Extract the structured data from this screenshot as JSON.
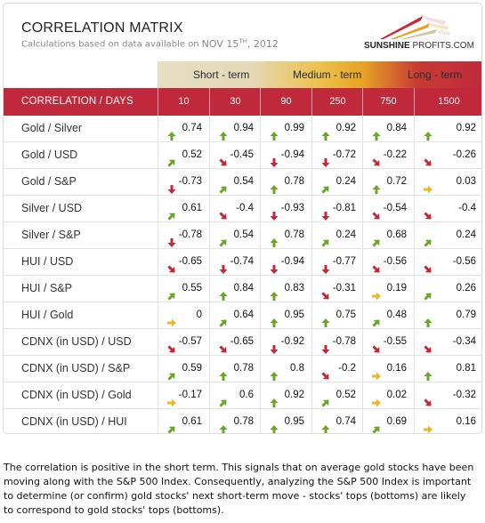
{
  "header": {
    "title": "CORRELATION MATRIX",
    "subtitle": "Calculations based on data available on",
    "date_main": "NOV 15",
    "date_sup": "TH",
    "date_year": ", 2012",
    "logo_bold": "SUNSHINE",
    "logo_rest": " PROFITS.COM"
  },
  "terms": [
    "Short - term",
    "Medium - term",
    "Long - term"
  ],
  "colors": {
    "header_red": "#c0283c",
    "up": "#6aa62a",
    "down": "#c0283c",
    "flat": "#f0b428"
  },
  "chart_data": {
    "type": "table",
    "title": "CORRELATION MATRIX",
    "row_header": "CORRELATION / DAYS",
    "columns": [
      "10",
      "30",
      "90",
      "250",
      "750",
      "1500"
    ],
    "column_groups": [
      {
        "name": "Short - term",
        "columns": [
          "10",
          "30"
        ]
      },
      {
        "name": "Medium - term",
        "columns": [
          "90",
          "250"
        ]
      },
      {
        "name": "Long - term",
        "columns": [
          "750",
          "1500"
        ]
      }
    ],
    "rows": [
      {
        "label": "Gold / Silver",
        "values": [
          "0.74",
          "0.94",
          "0.99",
          "0.92",
          "0.84",
          "0.92"
        ],
        "arrows": [
          "up",
          "up",
          "up",
          "up",
          "up",
          "up"
        ]
      },
      {
        "label": "Gold / USD",
        "values": [
          "0.52",
          "-0.45",
          "-0.94",
          "-0.72",
          "-0.22",
          "-0.26"
        ],
        "arrows": [
          "up-right",
          "down-right",
          "down",
          "down",
          "down-right",
          "down-right"
        ]
      },
      {
        "label": "Gold / S&P",
        "values": [
          "-0.73",
          "0.54",
          "0.78",
          "0.24",
          "0.72",
          "0.03"
        ],
        "arrows": [
          "down",
          "up-right",
          "up",
          "up-right",
          "up",
          "right"
        ]
      },
      {
        "label": "Silver / USD",
        "values": [
          "0.61",
          "-0.4",
          "-0.93",
          "-0.81",
          "-0.54",
          "-0.4"
        ],
        "arrows": [
          "up-right",
          "down-right",
          "down",
          "down",
          "down-right",
          "down-right"
        ]
      },
      {
        "label": "Silver / S&P",
        "values": [
          "-0.78",
          "0.54",
          "0.78",
          "0.24",
          "0.68",
          "0.24"
        ],
        "arrows": [
          "down",
          "up-right",
          "up",
          "up-right",
          "up-right",
          "up-right"
        ]
      },
      {
        "label": "HUI / USD",
        "values": [
          "-0.65",
          "-0.74",
          "-0.94",
          "-0.77",
          "-0.56",
          "-0.56"
        ],
        "arrows": [
          "down-right",
          "down",
          "down",
          "down",
          "down-right",
          "down-right"
        ]
      },
      {
        "label": "HUI / S&P",
        "values": [
          "0.55",
          "0.84",
          "0.83",
          "-0.31",
          "0.19",
          "0.26"
        ],
        "arrows": [
          "up-right",
          "up",
          "up",
          "down-right",
          "right",
          "up-right"
        ]
      },
      {
        "label": "HUI / Gold",
        "values": [
          "0",
          "0.64",
          "0.95",
          "0.75",
          "0.48",
          "0.79"
        ],
        "arrows": [
          "right",
          "up-right",
          "up",
          "up",
          "up-right",
          "up"
        ]
      },
      {
        "label": "CDNX (in USD) / USD",
        "values": [
          "-0.57",
          "-0.65",
          "-0.92",
          "-0.78",
          "-0.55",
          "-0.34"
        ],
        "arrows": [
          "down-right",
          "down-right",
          "down",
          "down",
          "down-right",
          "down-right"
        ]
      },
      {
        "label": "CDNX (in USD) / S&P",
        "values": [
          "0.59",
          "0.78",
          "0.8",
          "-0.2",
          "0.16",
          "0.81"
        ],
        "arrows": [
          "up-right",
          "up",
          "up",
          "down-right",
          "right",
          "up"
        ]
      },
      {
        "label": "CDNX (in USD) / Gold",
        "values": [
          "-0.17",
          "0.6",
          "0.92",
          "0.52",
          "0.02",
          "-0.32"
        ],
        "arrows": [
          "right",
          "up-right",
          "up",
          "up-right",
          "right",
          "down-right"
        ]
      },
      {
        "label": "CDNX (in USD) / HUI",
        "values": [
          "0.61",
          "0.78",
          "0.95",
          "0.74",
          "0.69",
          "0.16"
        ],
        "arrows": [
          "up-right",
          "up",
          "up",
          "up",
          "up-right",
          "right"
        ]
      }
    ]
  },
  "description": "The correlation is positive in the short term. This signals that on average gold stocks have been moving along with the S&P 500 Index. Consequently, analyzing the S&P 500 Index is important to determine (or confirm) gold stocks' next short-term move - stocks' tops (bottoms) are likely to correspond to gold stocks' tops (bottoms)."
}
